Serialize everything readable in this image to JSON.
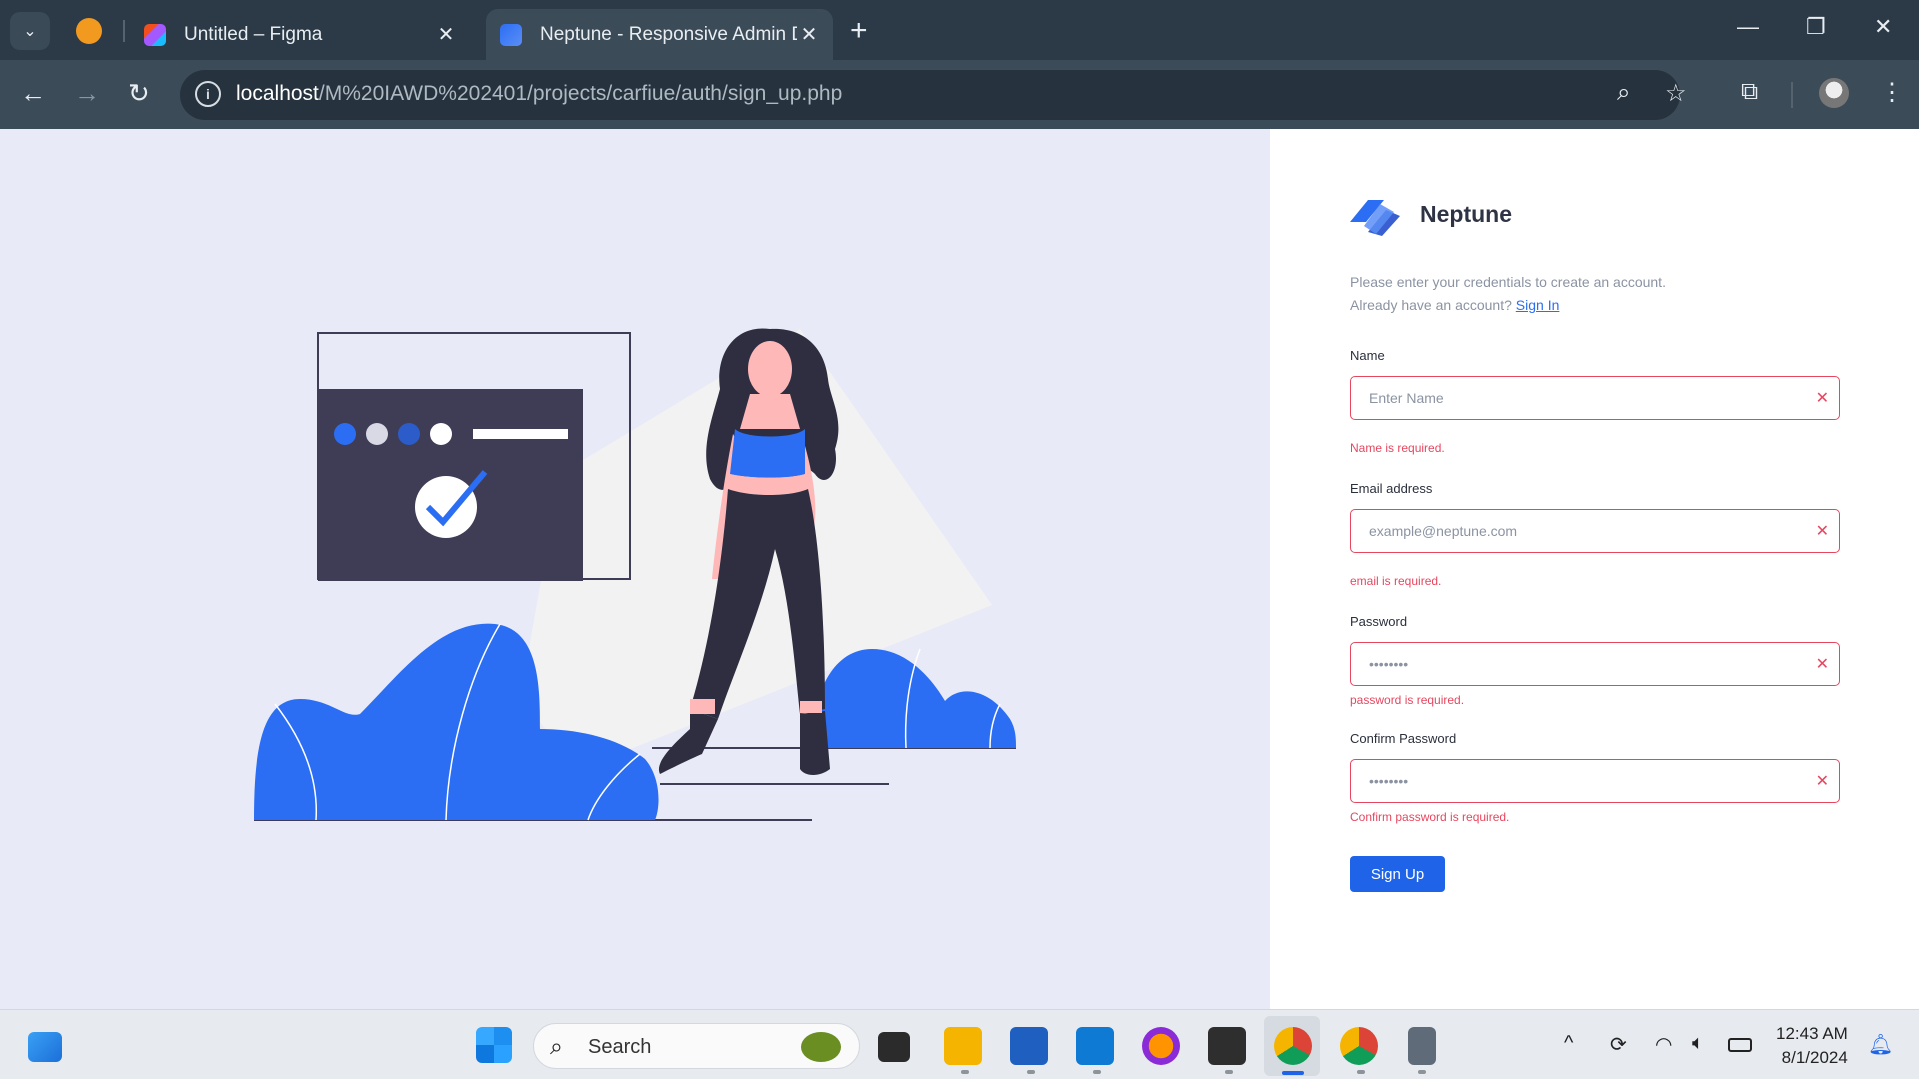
{
  "browser": {
    "tabs": [
      {
        "title": "Untitled – Figma"
      },
      {
        "title": "Neptune - Responsive Admin D"
      }
    ],
    "url_host": "localhost",
    "url_path": "/M%20IAWD%202401/projects/carfiue/auth/sign_up.php"
  },
  "brand": {
    "name": "Neptune",
    "color": "#2b6ef3"
  },
  "intro": {
    "line1": "Please enter your credentials to create an account.",
    "line2_prefix": "Already have an account?",
    "signin_link": "Sign In"
  },
  "form": {
    "name": {
      "label": "Name",
      "placeholder": "Enter Name",
      "error": "Name is required."
    },
    "email": {
      "label": "Email address",
      "placeholder": "example@neptune.com",
      "error": "email is required."
    },
    "password": {
      "label": "Password",
      "value": "••••••••",
      "error": "password is required."
    },
    "confirm": {
      "label": "Confirm Password",
      "value": "••••••••",
      "error": "Confirm password is required."
    },
    "submit_label": "Sign Up"
  },
  "taskbar": {
    "search_label": "Search",
    "time": "12:43 AM",
    "date": "8/1/2024"
  },
  "colors": {
    "accent": "#1f64e8",
    "error": "#e6475f",
    "illustration_blue": "#2b6ef3",
    "illustration_dark": "#3f3d56"
  }
}
